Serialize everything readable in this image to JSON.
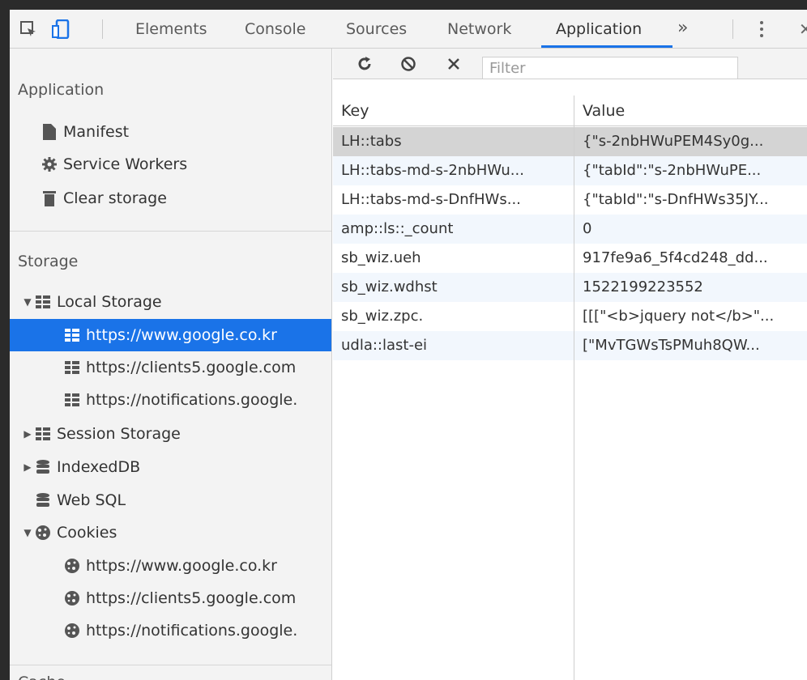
{
  "toolbar": {
    "tabs": [
      "Elements",
      "Console",
      "Sources",
      "Network",
      "Application"
    ],
    "overflow": "»",
    "close": "✕"
  },
  "sidebar": {
    "application_title": "Application",
    "application_items": [
      "Manifest",
      "Service Workers",
      "Clear storage"
    ],
    "storage_title": "Storage",
    "local_storage": "Local Storage",
    "local_origins": [
      "https://www.google.co.kr",
      "https://clients5.google.com",
      "https://notifications.google."
    ],
    "session_storage": "Session Storage",
    "indexeddb": "IndexedDB",
    "websql": "Web SQL",
    "cookies": "Cookies",
    "cookie_origins": [
      "https://www.google.co.kr",
      "https://clients5.google.com",
      "https://notifications.google."
    ],
    "cache_title": "Cache"
  },
  "filter": {
    "placeholder": "Filter"
  },
  "table": {
    "columns": [
      "Key",
      "Value"
    ],
    "rows": [
      {
        "key": "LH::tabs",
        "value": "{\"s-2nbHWuPEM4Sy0g..."
      },
      {
        "key": "LH::tabs-md-s-2nbHWu...",
        "value": "{\"tabId\":\"s-2nbHWuPE..."
      },
      {
        "key": "LH::tabs-md-s-DnfHWs...",
        "value": "{\"tabId\":\"s-DnfHWs35JY..."
      },
      {
        "key": "amp::ls::_count",
        "value": "0"
      },
      {
        "key": "sb_wiz.ueh",
        "value": "917fe9a6_5f4cd248_dd..."
      },
      {
        "key": "sb_wiz.wdhst",
        "value": "1522199223552"
      },
      {
        "key": "sb_wiz.zpc.",
        "value": "[[[\"<b>jquery not</b>\"..."
      },
      {
        "key": "udla::last-ei",
        "value": "[\"MvTGWsTsPMuh8QW..."
      }
    ]
  },
  "colors": {
    "accent": "#1a73e8",
    "selected_row": "#d4d4d4",
    "alt_row": "#f2f7fd"
  }
}
